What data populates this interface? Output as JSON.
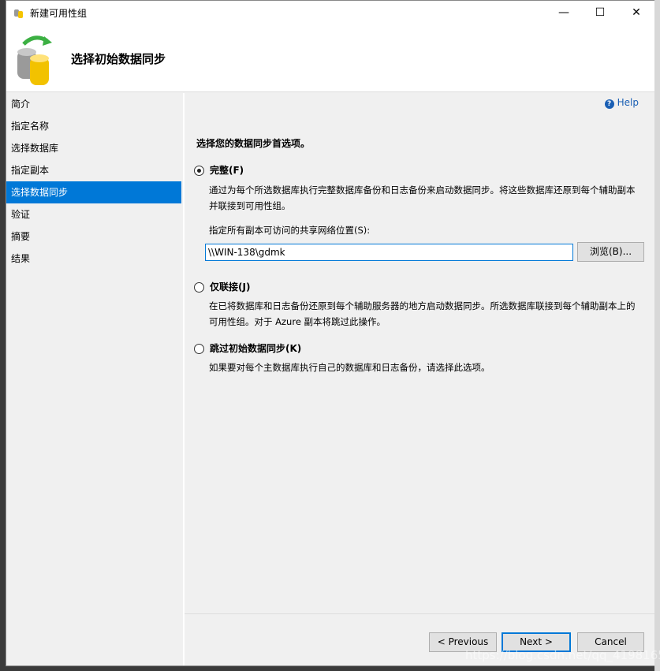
{
  "window": {
    "title": "新建可用性组",
    "minimize": "—",
    "maximize": "☐",
    "close": "✕"
  },
  "header": {
    "title": "选择初始数据同步"
  },
  "nav": {
    "items": [
      {
        "label": "简介"
      },
      {
        "label": "指定名称"
      },
      {
        "label": "选择数据库"
      },
      {
        "label": "指定副本"
      },
      {
        "label": "选择数据同步",
        "selected": true
      },
      {
        "label": "验证"
      },
      {
        "label": "摘要"
      },
      {
        "label": "结果"
      }
    ]
  },
  "content": {
    "help": "Help",
    "prompt": "选择您的数据同步首选项。",
    "options": [
      {
        "label": "完整(F)",
        "selected": true,
        "description": "通过为每个所选数据库执行完整数据库备份和日志备份来启动数据同步。将这些数据库还原到每个辅助副本并联接到可用性组。"
      },
      {
        "label": "仅联接(J)",
        "selected": false,
        "description": "在已将数据库和日志备份还原到每个辅助服务器的地方启动数据同步。所选数据库联接到每个辅助副本上的可用性组。对于 Azure 副本将跳过此操作。"
      },
      {
        "label": "跳过初始数据同步(K)",
        "selected": false,
        "description": "如果要对每个主数据库执行自己的数据库和日志备份，请选择此选项。"
      }
    ],
    "share_label": "指定所有副本可访问的共享网络位置(S):",
    "share_value": "\\\\WIN-138\\gdmk",
    "browse": "浏览(B)..."
  },
  "footer": {
    "previous": "< Previous",
    "next": "Next >",
    "cancel": "Cancel"
  },
  "watermark": "https://blog.csdn.net/qq_41981651",
  "accent": "#0078d7"
}
